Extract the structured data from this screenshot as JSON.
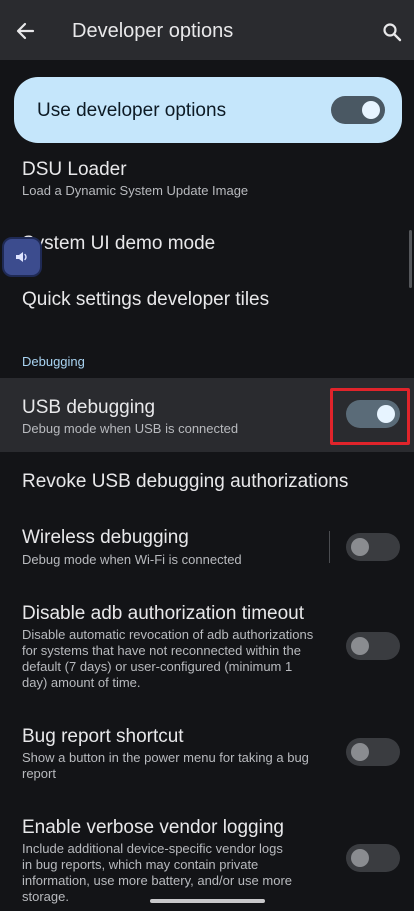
{
  "appbar": {
    "title": "Developer options"
  },
  "master": {
    "label": "Use developer options",
    "enabled": true
  },
  "items": {
    "dsu": {
      "title": "DSU Loader",
      "subtitle": "Load a Dynamic System Update Image"
    },
    "sysui": {
      "title": "System UI demo mode"
    },
    "qs_tiles": {
      "title": "Quick settings developer tiles"
    }
  },
  "section": {
    "debugging": "Debugging"
  },
  "debug": {
    "usb": {
      "title": "USB debugging",
      "subtitle": "Debug mode when USB is connected",
      "enabled": true
    },
    "revoke": {
      "title": "Revoke USB debugging authorizations"
    },
    "wireless": {
      "title": "Wireless debugging",
      "subtitle": "Debug mode when Wi-Fi is connected",
      "enabled": false
    },
    "adb_timeout": {
      "title": "Disable adb authorization timeout",
      "subtitle_lines": [
        "Disable automatic revocation of adb authorizations",
        "for systems that have not reconnected within the",
        "default (7 days) or user-configured (minimum 1",
        "day) amount of time."
      ],
      "enabled": false
    },
    "bugreport": {
      "title": "Bug report shortcut",
      "subtitle_lines": [
        "Show a button in the power menu for taking a bug",
        "report"
      ],
      "enabled": false
    },
    "verbose": {
      "title": "Enable verbose vendor logging",
      "subtitle_lines": [
        "Include additional device-specific vendor logs",
        "in bug reports, which may contain private",
        "information, use more battery, and/or use more",
        "storage."
      ],
      "enabled": false
    }
  },
  "colors": {
    "accent_card": "#c5e6fb",
    "highlight": "#e0242b",
    "section_header": "#a9d4f2"
  },
  "icons": {
    "back": "arrow-left-icon",
    "search": "search-icon",
    "bubble": "volume-icon"
  }
}
